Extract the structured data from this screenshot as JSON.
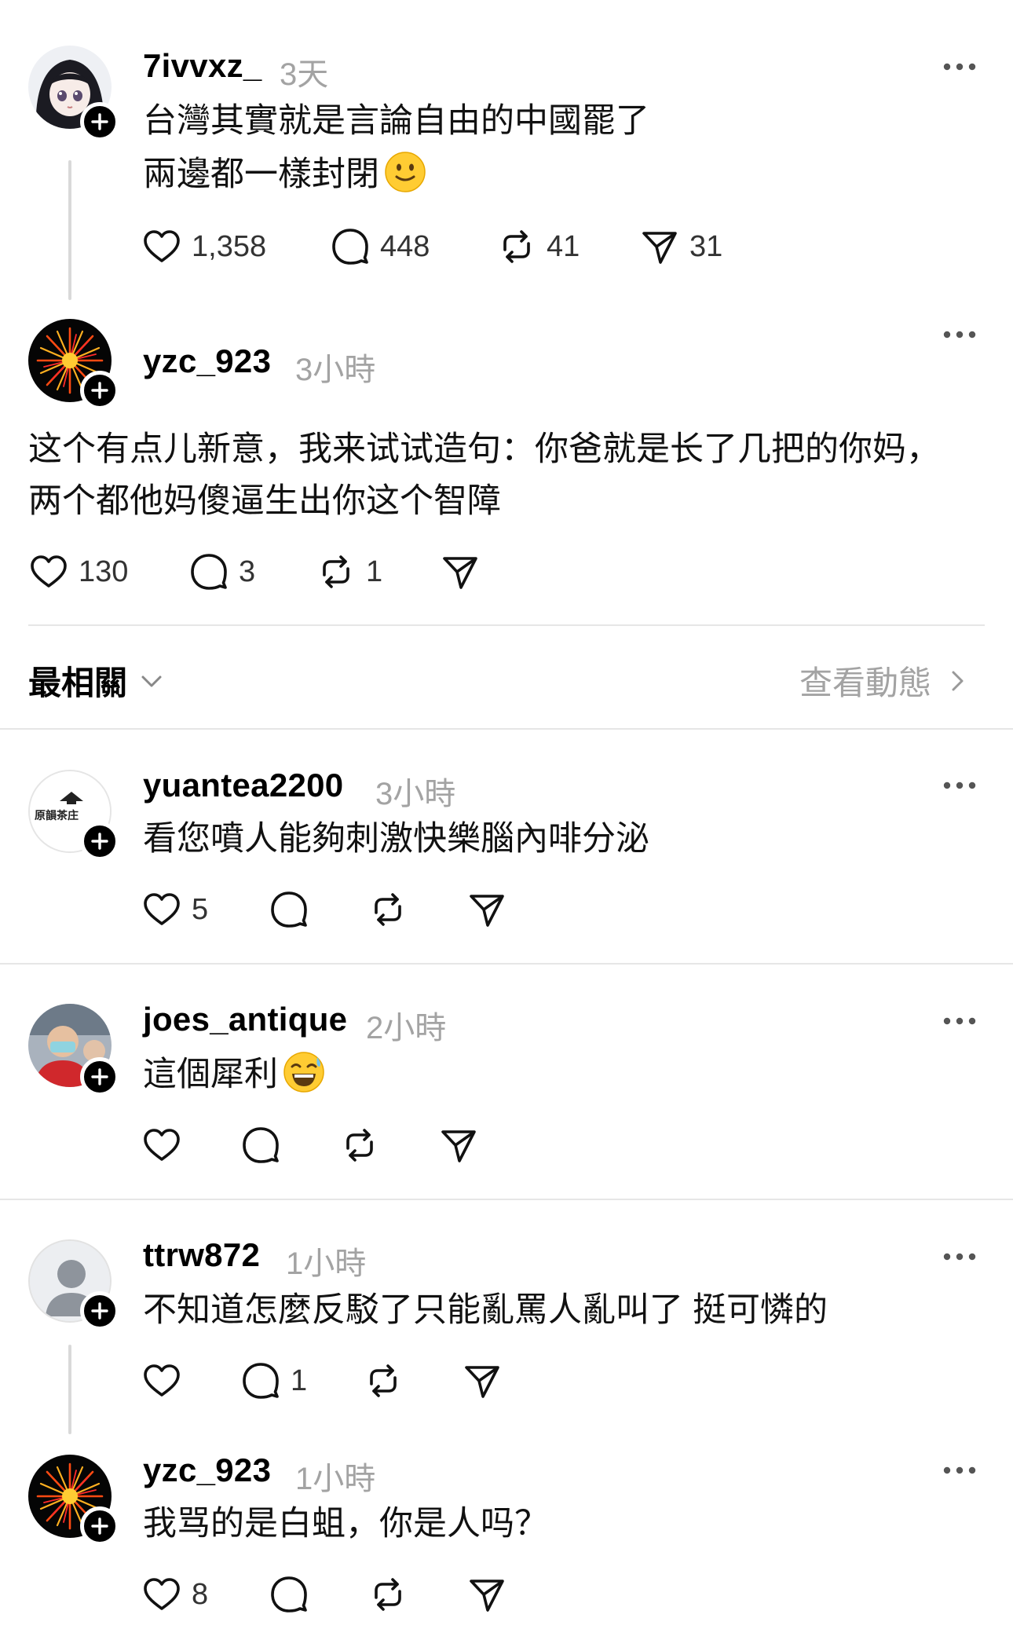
{
  "posts": [
    {
      "username": "7ivvxz_",
      "time": "3天",
      "lines": [
        "台灣其實就是言論自由的中國罷了",
        "兩邊都一樣封閉"
      ],
      "emoji": "slightly-smiling-face",
      "likes": "1,358",
      "replies": "448",
      "reposts": "41",
      "shares": "31"
    },
    {
      "username": "yzc_923",
      "time": "3小時",
      "lines": [
        "这个有点儿新意，我来试试造句：你爸就是长了几把的你妈，",
        "两个都他妈傻逼生出你这个智障"
      ],
      "likes": "130",
      "replies": "3",
      "reposts": "1",
      "shares": ""
    }
  ],
  "filter": {
    "label": "最相關",
    "activity_link": "查看動態"
  },
  "replies": [
    {
      "username": "yuantea2200",
      "time": "3小時",
      "text": "看您噴人能夠刺激快樂腦內啡分泌",
      "likes": "5",
      "replies": "",
      "reposts": "",
      "shares": "",
      "avatar_text": "原韻茶庄"
    },
    {
      "username": "joes_antique",
      "time": "2小時",
      "text": "這個犀利",
      "emoji": "grinning-sweat-face",
      "likes": "",
      "replies": "",
      "reposts": "",
      "shares": ""
    },
    {
      "username": "ttrw872",
      "time": "1小時",
      "text": "不知道怎麼反駁了只能亂罵人亂叫了 挺可憐的",
      "likes": "",
      "replies": "1",
      "reposts": "",
      "shares": ""
    },
    {
      "username": "yzc_923",
      "time": "1小時",
      "text": "我骂的是白蛆，你是人吗？",
      "likes": "8",
      "replies": "",
      "reposts": "",
      "shares": ""
    }
  ],
  "colors": {
    "secondary_text": "#a3a3a3",
    "divider": "#e6e6e6",
    "thread_line": "#d9d9d9"
  }
}
